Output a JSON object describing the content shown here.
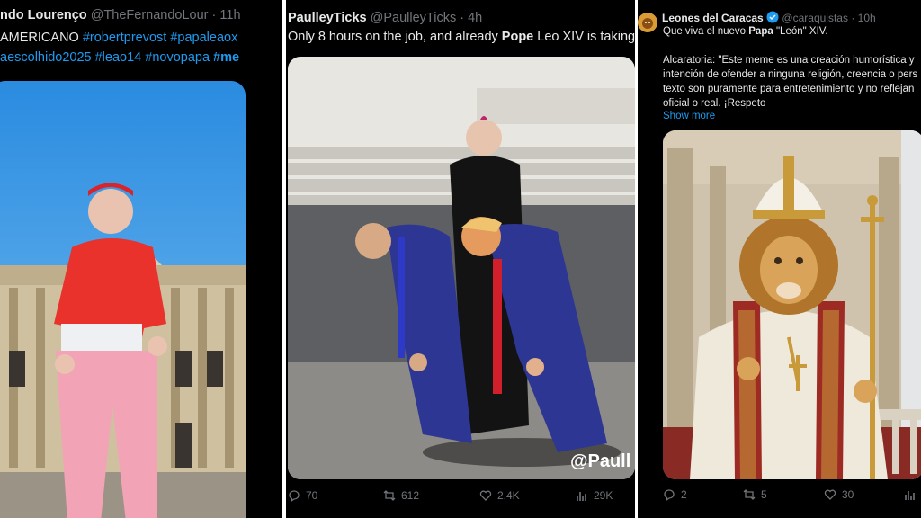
{
  "panel1": {
    "display_name": "ndo Lourenço",
    "handle": "@TheFernandoLour",
    "time": "· 11h",
    "text_line1_plain": "AMERICANO ",
    "text_line1_tags": "#robertprevost #papaleaox",
    "text_line2_tags": "aescolhido2025 #leao14 #novopapa ",
    "text_line2_bold": "#me",
    "image_icon": "cardinal-dancing-meme-image"
  },
  "panel2": {
    "display_name": "PaulleyTicks",
    "handle": "@PaulleyTicks",
    "time": "· 4h",
    "text_pre": "Only 8 hours on the job, and already ",
    "text_bold": "Pope",
    "text_post": " Leo XIV is taking ou",
    "watermark": "@Paull",
    "image_icon": "pope-carrying-politicians-meme-image",
    "actions": {
      "replies": "70",
      "reposts": "612",
      "likes": "2.4K",
      "views": "29K"
    }
  },
  "panel3": {
    "display_name": "Leones del Caracas",
    "handle": "@caraquistas",
    "time": "· 10h",
    "line1_pre": "Que viva el nuevo ",
    "line1_bold": "Papa",
    "line1_post": " \"León\" XIV.",
    "line2": "Alcaratoria: \"Este meme es una creación humorística y",
    "line3": "intención de ofender a ninguna religión, creencia o pers",
    "line4": "texto son puramente para entretenimiento y no reflejan",
    "line5": "oficial o real. ¡Respeto",
    "show_more": "Show more",
    "image_icon": "lion-pope-image",
    "actions": {
      "replies": "2",
      "reposts": "5",
      "likes": "30"
    }
  },
  "colors": {
    "background": "#000000",
    "text": "#e7e9ea",
    "muted": "#71767b",
    "link": "#1d9bf0",
    "separator": "#ffffff"
  }
}
